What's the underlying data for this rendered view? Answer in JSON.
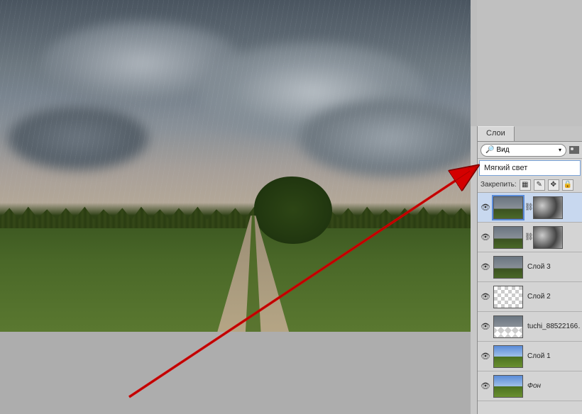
{
  "panel": {
    "tab_label": "Слои",
    "filter_label": "Вид",
    "blend_mode": "Мягкий свет",
    "lock_label": "Закрепить:"
  },
  "layers": [
    {
      "name": "",
      "has_mask": true,
      "selected": true,
      "italic": false,
      "thumb": "t-stormy",
      "mask": "t-clouds"
    },
    {
      "name": "",
      "has_mask": true,
      "selected": false,
      "italic": false,
      "thumb": "t-stormy",
      "mask": "t-clouds"
    },
    {
      "name": "Слой 3",
      "has_mask": false,
      "selected": false,
      "italic": false,
      "thumb": "t-stormy"
    },
    {
      "name": "Слой 2",
      "has_mask": false,
      "selected": false,
      "italic": false,
      "thumb": "t-checker"
    },
    {
      "name": "tuchi_88522166…",
      "has_mask": false,
      "selected": false,
      "italic": false,
      "thumb": "t-half"
    },
    {
      "name": "Слой 1",
      "has_mask": false,
      "selected": false,
      "italic": false,
      "thumb": "t-sky"
    },
    {
      "name": "Фон",
      "has_mask": false,
      "selected": false,
      "italic": true,
      "thumb": "t-sky"
    }
  ]
}
